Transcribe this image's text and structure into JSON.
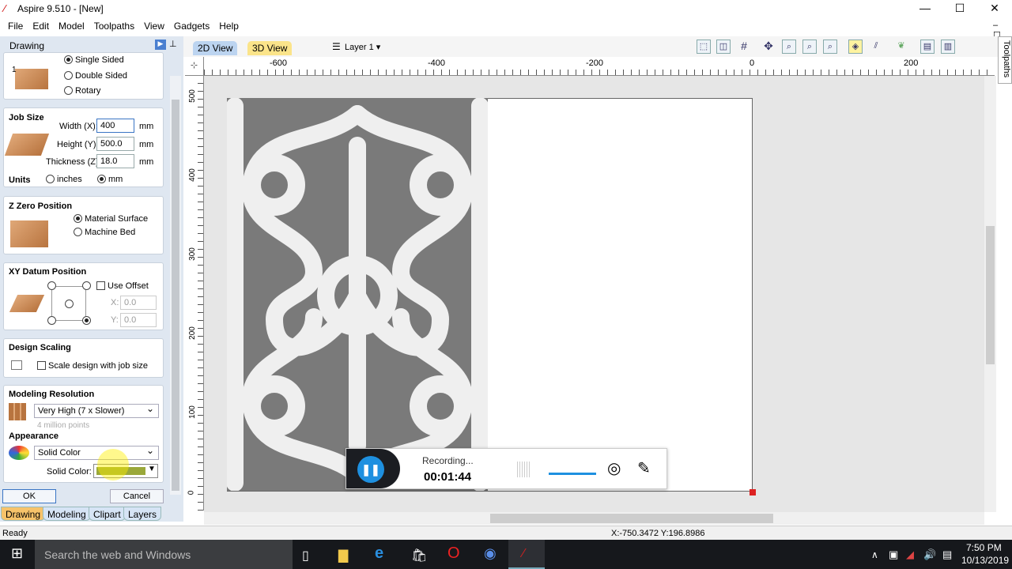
{
  "window": {
    "title": "Aspire 9.510 - [New]",
    "minimize": "—",
    "maximize": "☐",
    "close": "✕"
  },
  "menu": [
    "File",
    "Edit",
    "Model",
    "Toolpaths",
    "View",
    "Gadgets",
    "Help"
  ],
  "panel": {
    "title": "Drawing",
    "job_type": {
      "title": "Job Type",
      "options": [
        "Single Sided",
        "Double Sided",
        "Rotary"
      ],
      "selected": "Single Sided"
    },
    "job_size": {
      "title": "Job Size",
      "width_label": "Width (X):",
      "width": "400",
      "height_label": "Height (Y):",
      "height": "500.0",
      "thickness_label": "Thickness (Z):",
      "thickness": "18.0",
      "unit": "mm",
      "units_label": "Units",
      "units_options": [
        "inches",
        "mm"
      ],
      "units_selected": "mm"
    },
    "z_zero": {
      "title": "Z Zero Position",
      "options": [
        "Material Surface",
        "Machine Bed"
      ],
      "selected": "Material Surface"
    },
    "xy_datum": {
      "title": "XY Datum Position",
      "use_offset": "Use Offset",
      "x_label": "X:",
      "x": "0.0",
      "y_label": "Y:",
      "y": "0.0"
    },
    "design_scaling": {
      "title": "Design Scaling",
      "checkbox": "Scale design with job size"
    },
    "modeling": {
      "title": "Modeling Resolution",
      "value": "Very High (7 x Slower)",
      "hint": "4 million points"
    },
    "appearance": {
      "title": "Appearance",
      "value": "Solid Color",
      "color_label": "Solid Color:",
      "color": "#9aa83a"
    },
    "ok": "OK",
    "cancel": "Cancel",
    "tabs": [
      "Drawing",
      "Modeling",
      "Clipart",
      "Layers"
    ],
    "active_tab": "Drawing"
  },
  "view_tabs": [
    "2D View",
    "3D View"
  ],
  "layer": "Layer 1",
  "side_tab": "Toolpaths",
  "ruler": {
    "x_labels": [
      "-600",
      "-400",
      "-200",
      "0",
      "200"
    ],
    "y_labels": [
      "500",
      "400",
      "300",
      "200",
      "100",
      "0"
    ]
  },
  "recorder": {
    "status": "Recording...",
    "time": "00:01:44"
  },
  "status": {
    "text": "Ready",
    "coords": "X:-750.3472 Y:196.8986"
  },
  "taskbar": {
    "search": "Search the web and Windows",
    "time": "7:50 PM",
    "date": "10/13/2019"
  }
}
